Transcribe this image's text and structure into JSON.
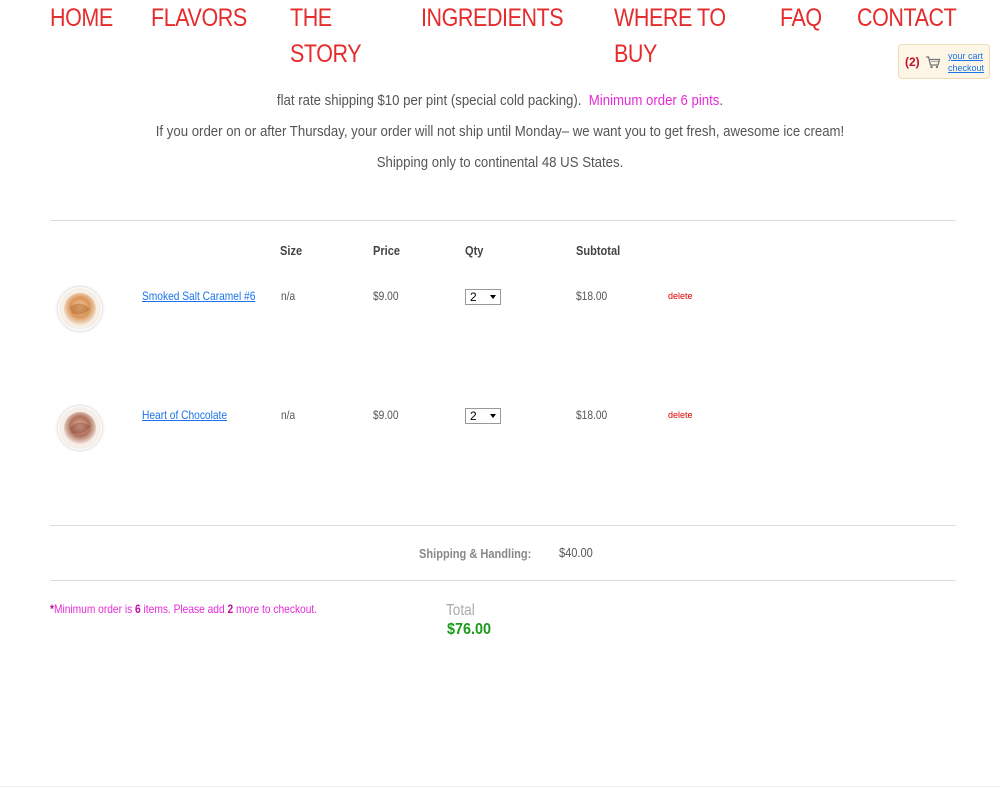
{
  "nav": {
    "items": [
      "HOME",
      "FLAVORS",
      "THE STORY",
      "INGREDIENTS",
      "WHERE TO BUY",
      "FAQ",
      "CONTACT"
    ]
  },
  "cart_widget": {
    "count": "(2)",
    "your_cart": "your cart",
    "checkout": "checkout",
    "icon": "shopping-cart-icon"
  },
  "notice": {
    "line1_a": "flat rate shipping $10 per pint (special cold packing).",
    "line1_b": "Minimum order 6 pints",
    "line1_c": ".",
    "line2": "If you order on or after Thursday, your order will not ship until Monday– we want you to get fresh, awesome ice cream!",
    "line3": "Shipping only to continental 48 US States."
  },
  "table": {
    "headers": {
      "size": "Size",
      "price": "Price",
      "qty": "Qty",
      "subtotal": "Subtotal"
    },
    "rows": [
      {
        "name": "Smoked Salt Caramel #6",
        "size": "n/a",
        "price": "$9.00",
        "qty": "2",
        "subtotal": "$18.00",
        "delete": "delete"
      },
      {
        "name": "Heart of Chocolate",
        "size": "n/a",
        "price": "$9.00",
        "qty": "2",
        "subtotal": "$18.00",
        "delete": "delete"
      }
    ]
  },
  "shipping": {
    "label": "Shipping & Handling:",
    "value": "$40.00"
  },
  "minimum": {
    "star": "*",
    "part1": "Minimum order is ",
    "min_count": "6",
    "part2": " items. Please add ",
    "add_count": "2",
    "part3": " more to checkout."
  },
  "total": {
    "label": "Total",
    "value": "$76.00"
  },
  "colors": {
    "nav": "#e52b2b",
    "accent_pink": "#e62ad6",
    "total_green": "#1a9a1a",
    "link_blue": "#1a73e8"
  }
}
